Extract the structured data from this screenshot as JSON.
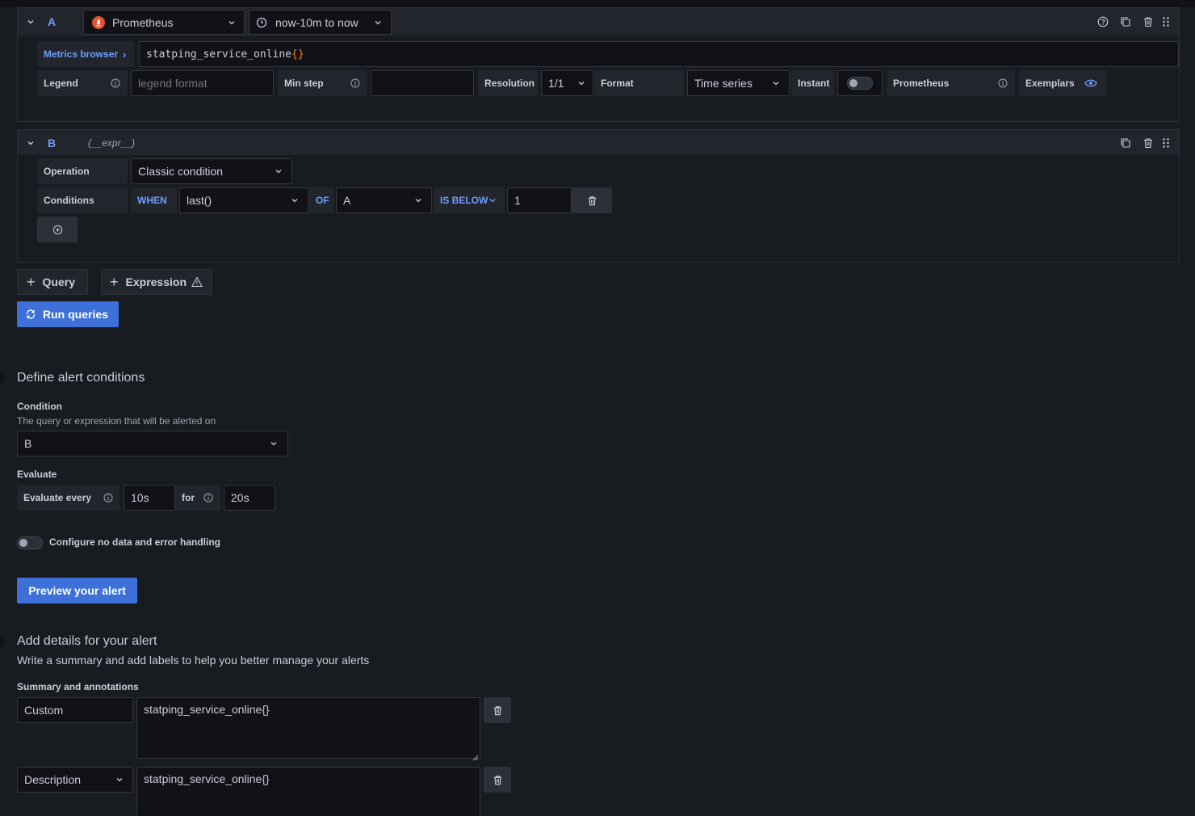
{
  "queryA": {
    "ref_id": "A",
    "datasource": "Prometheus",
    "time_range": "now-10m to now",
    "metrics_browser": "Metrics browser",
    "query_text": "statping_service_online",
    "query_braces": "{}",
    "legend_label": "Legend",
    "legend_placeholder": "legend format",
    "min_step_label": "Min step",
    "min_step_value": "",
    "resolution_label": "Resolution",
    "resolution_value": "1/1",
    "format_label": "Format",
    "format_value": "Time series",
    "instant_label": "Instant",
    "prometheus_label": "Prometheus",
    "exemplars_label": "Exemplars"
  },
  "queryB": {
    "ref_id": "B",
    "expr_hint": "(__expr__)",
    "operation_label": "Operation",
    "operation_value": "Classic condition",
    "conditions_label": "Conditions",
    "when_label": "WHEN",
    "reducer_value": "last()",
    "of_label": "OF",
    "query_value": "A",
    "evaluator_label": "IS BELOW",
    "threshold_value": "1"
  },
  "actions": {
    "add_query": "Query",
    "add_expression": "Expression",
    "run_queries": "Run queries"
  },
  "conditions_section": {
    "title": "Define alert conditions",
    "condition_label": "Condition",
    "condition_desc": "The query or expression that will be alerted on",
    "condition_value": "B",
    "evaluate_label": "Evaluate",
    "evaluate_every_label": "Evaluate every",
    "evaluate_every_value": "10s",
    "for_label": "for",
    "for_value": "20s",
    "no_data_toggle_label": "Configure no data and error handling",
    "preview_button": "Preview your alert"
  },
  "details_section": {
    "title": "Add details for your alert",
    "desc": "Write a summary and add labels to help you better manage your alerts",
    "annotations_label": "Summary and annotations",
    "annotations": [
      {
        "key": "Custom",
        "value": "statping_service_online{}"
      },
      {
        "key": "Description",
        "value": "statping_service_online{}"
      }
    ]
  },
  "colors": {
    "accent": "#6e9fff",
    "primary_button": "#3d71d9",
    "prometheus_logo": "#e6522c",
    "query_brace": "#ff7f0e"
  }
}
